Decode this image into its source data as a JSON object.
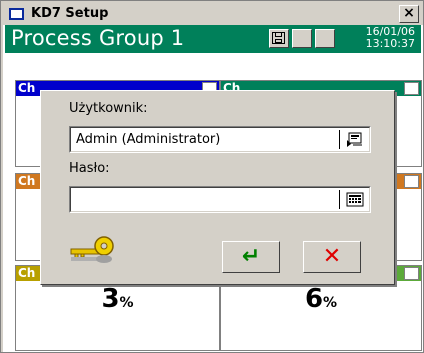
{
  "window": {
    "title": "KD7 Setup",
    "close_glyph": "×"
  },
  "header": {
    "title": "Process Group 1",
    "date": "16/01/06",
    "time": "13:10:37",
    "color": "#00805a"
  },
  "tiles": [
    {
      "label": "Ch",
      "color": "#0000cc"
    },
    {
      "label": "Ch",
      "color": "#00805a"
    },
    {
      "label": "Ch",
      "color": "#d07820"
    },
    {
      "label": "",
      "color": "#d07820"
    },
    {
      "label": "Ch",
      "color": "#b8a000"
    },
    {
      "label": "",
      "color": "#5caa3a"
    }
  ],
  "values": {
    "left": "3",
    "left_unit": "%",
    "right": "6",
    "right_unit": "%"
  },
  "login_dialog": {
    "user_label": "Użytkownik:",
    "user_value": "Admin (Administrator)",
    "password_label": "Hasło:",
    "password_value": "",
    "user_icon": "user-select-icon",
    "password_icon": "keypad-icon",
    "key_icon": "key-icon",
    "ok_glyph": "↵",
    "cancel_glyph": "✕",
    "ok_color": "#008000",
    "cancel_color": "#e00000"
  }
}
